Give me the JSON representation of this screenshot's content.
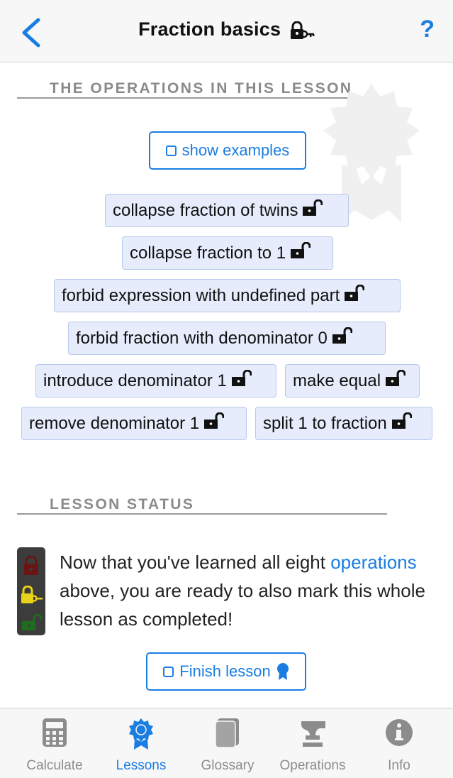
{
  "header": {
    "title": "Fraction basics",
    "back_icon": "chevron-left-icon",
    "help_label": "?",
    "title_icon": "lock-with-key-icon"
  },
  "operations_section": {
    "title": "THE OPERATIONS IN THIS LESSON",
    "show_examples_label": "show examples",
    "operations": [
      {
        "label": "collapse fraction of twins"
      },
      {
        "label": "collapse fraction to 1"
      },
      {
        "label": "forbid expression with undefined part"
      },
      {
        "label": "forbid fraction with denominator 0"
      },
      {
        "label": "introduce denominator 1"
      },
      {
        "label": "make equal"
      },
      {
        "label": "remove denominator 1"
      },
      {
        "label": "split 1 to fraction"
      }
    ]
  },
  "status_section": {
    "title": "LESSON STATUS",
    "text_before": "Now that you've learned all eight ",
    "link_text": "operations",
    "text_after": " above, you are ready to also mark this whole lesson as completed!",
    "finish_label": "Finish lesson"
  },
  "tabbar": {
    "tabs": [
      {
        "label": "Calculate",
        "icon": "calculator-icon"
      },
      {
        "label": "Lessons",
        "icon": "award-ribbon-icon",
        "active": true
      },
      {
        "label": "Glossary",
        "icon": "book-icon"
      },
      {
        "label": "Operations",
        "icon": "anvil-icon"
      },
      {
        "label": "Info",
        "icon": "info-icon"
      }
    ]
  },
  "colors": {
    "accent": "#1a7de2",
    "op_background": "#e6ecfb",
    "op_border": "#b6c8ee",
    "status_locked": "#6a1414",
    "status_learning": "#e8d21a",
    "status_done": "#1f6b1f"
  }
}
